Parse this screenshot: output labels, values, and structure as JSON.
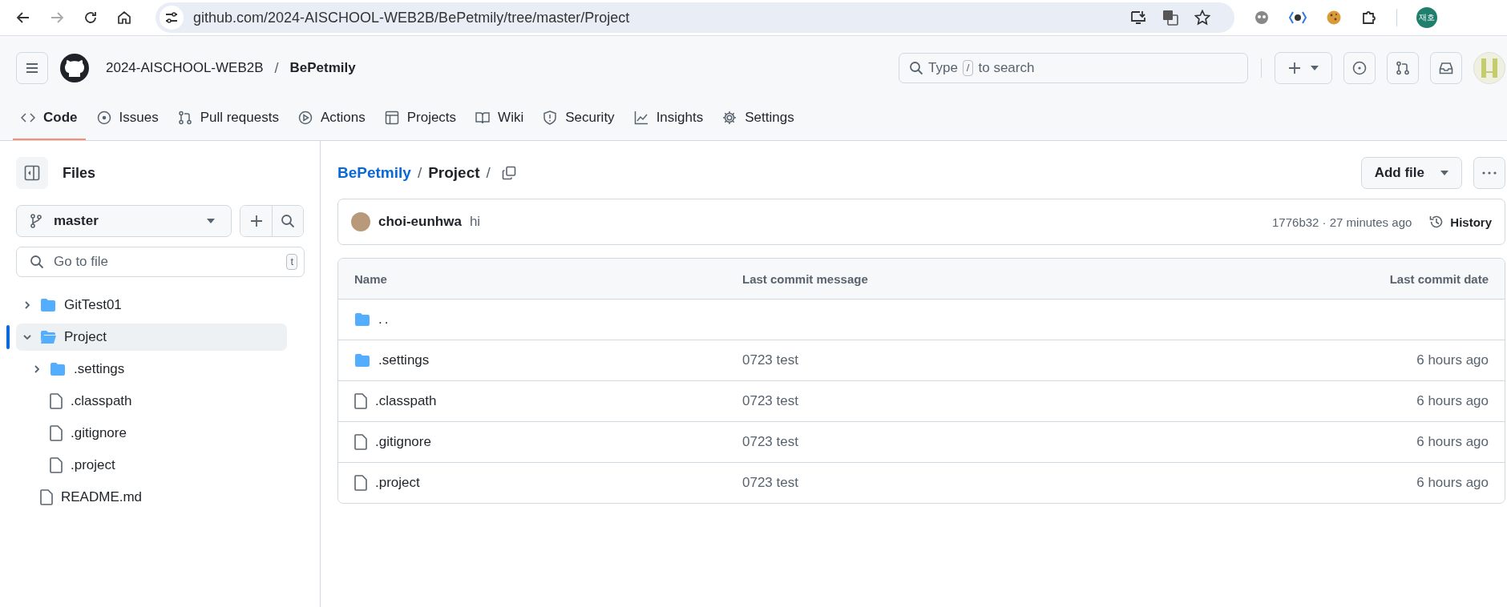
{
  "browser": {
    "url": "github.com/2024-AISCHOOL-WEB2B/BePetmily/tree/master/Project",
    "profile_initials": "재호"
  },
  "header": {
    "owner": "2024-AISCHOOL-WEB2B",
    "separator": "/",
    "repo": "BePetmily",
    "search_before": "Type",
    "search_key": "/",
    "search_after": "to search"
  },
  "nav_tabs": [
    {
      "label": "Code",
      "selected": true
    },
    {
      "label": "Issues",
      "selected": false
    },
    {
      "label": "Pull requests",
      "selected": false
    },
    {
      "label": "Actions",
      "selected": false
    },
    {
      "label": "Projects",
      "selected": false
    },
    {
      "label": "Wiki",
      "selected": false
    },
    {
      "label": "Security",
      "selected": false
    },
    {
      "label": "Insights",
      "selected": false
    },
    {
      "label": "Settings",
      "selected": false
    }
  ],
  "sidebar": {
    "title": "Files",
    "branch": "master",
    "file_search_placeholder": "Go to file",
    "shortcut_key": "t",
    "tree": [
      {
        "name": "GitTest01",
        "kind": "folder",
        "expanded": false,
        "selected": false
      },
      {
        "name": "Project",
        "kind": "folder",
        "expanded": true,
        "selected": true,
        "children": [
          {
            "name": ".settings",
            "kind": "folder",
            "expanded": false,
            "selected": false
          },
          {
            "name": ".classpath",
            "kind": "file",
            "selected": false
          },
          {
            "name": ".gitignore",
            "kind": "file",
            "selected": false
          },
          {
            "name": ".project",
            "kind": "file",
            "selected": false
          }
        ]
      },
      {
        "name": "README.md",
        "kind": "file",
        "selected": false
      }
    ]
  },
  "breadcrumb": {
    "repo": "BePetmily",
    "separator": "/",
    "path": "Project",
    "trailing": "/"
  },
  "add_file": "Add file",
  "commit": {
    "author": "choi-eunhwa",
    "message": "hi",
    "hash_time": "1776b32 · 27 minutes ago",
    "history": "History"
  },
  "table": {
    "columns": [
      "Name",
      "Last commit message",
      "Last commit date"
    ],
    "rows": [
      {
        "kind": "parent",
        "name": "..",
        "message": "",
        "date": ""
      },
      {
        "kind": "folder",
        "name": ".settings",
        "message": "0723 test",
        "date": "6 hours ago"
      },
      {
        "kind": "file",
        "name": ".classpath",
        "message": "0723 test",
        "date": "6 hours ago"
      },
      {
        "kind": "file",
        "name": ".gitignore",
        "message": "0723 test",
        "date": "6 hours ago"
      },
      {
        "kind": "file",
        "name": ".project",
        "message": "0723 test",
        "date": "6 hours ago"
      }
    ]
  }
}
